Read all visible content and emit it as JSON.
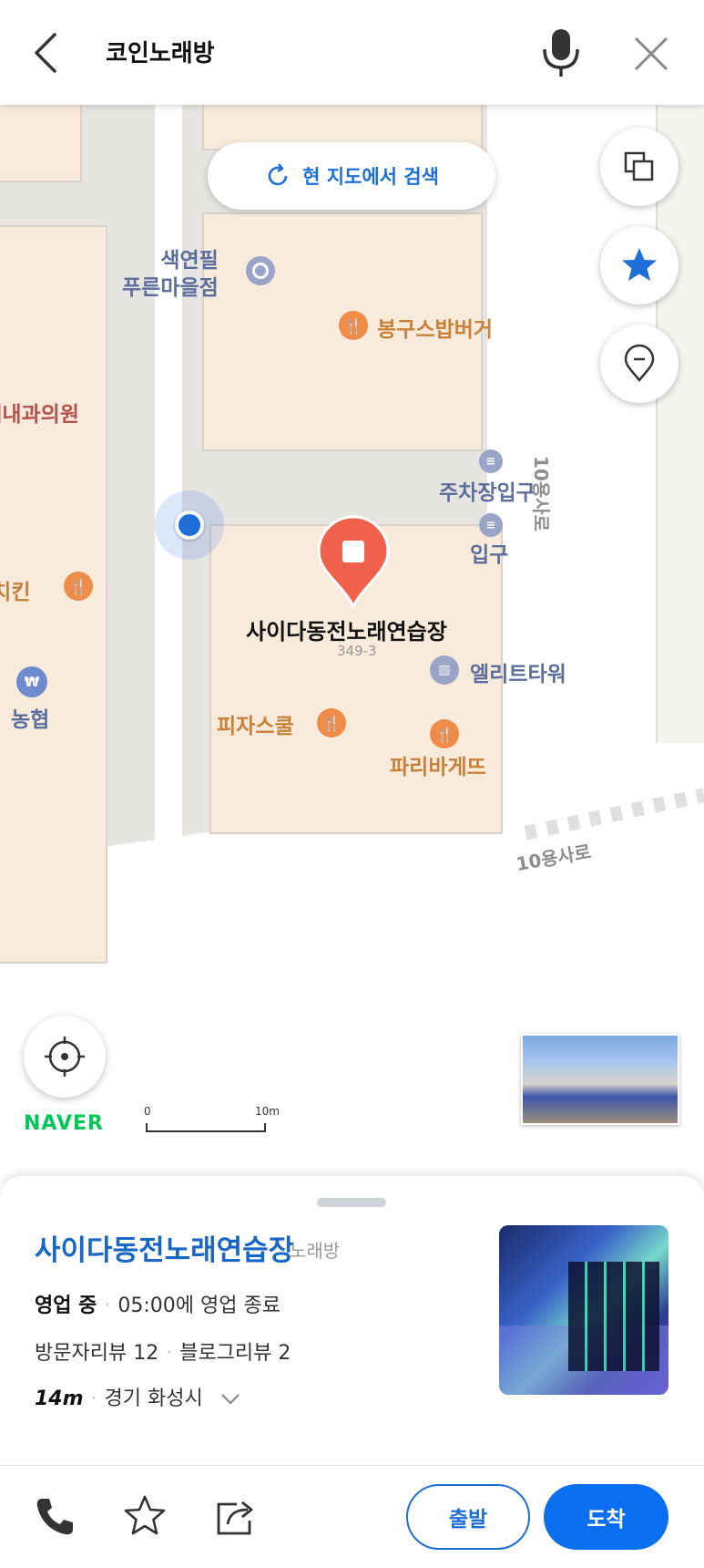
{
  "header": {
    "search_query": "코인노래방"
  },
  "map": {
    "search_here_label": "현 지도에서 검색",
    "pois": [
      {
        "label": "색연필\n푸른마을점"
      },
      {
        "label": "봉구스밥버거"
      },
      {
        "label": "연세내과의원"
      },
      {
        "label": "주차장입구"
      },
      {
        "label": "입구"
      },
      {
        "label": "스치킨"
      },
      {
        "label": "사이다동전노래연습장"
      },
      {
        "label": "엘리트타워"
      },
      {
        "label": "농협"
      },
      {
        "label": "피자스쿨"
      },
      {
        "label": "파리바게뜨"
      }
    ],
    "lot_number": "349-3",
    "road_labels": [
      "10용사로",
      "10용사로"
    ],
    "scale": {
      "start": "0",
      "end": "10m"
    },
    "brand": "NAVER"
  },
  "place": {
    "name": "사이다동전노래연습장",
    "category": "노래방",
    "status": "영업 중",
    "hours": "05:00에 영업 종료",
    "visitor_reviews": "방문자리뷰 12",
    "blog_reviews": "블로그리뷰 2",
    "distance": "14m",
    "location": "경기 화성시"
  },
  "actions": {
    "depart_label": "출발",
    "arrive_label": "도착"
  },
  "colors": {
    "accent": "#1f6fd6",
    "brand": "#03c75a",
    "marker": "#f0604a"
  }
}
